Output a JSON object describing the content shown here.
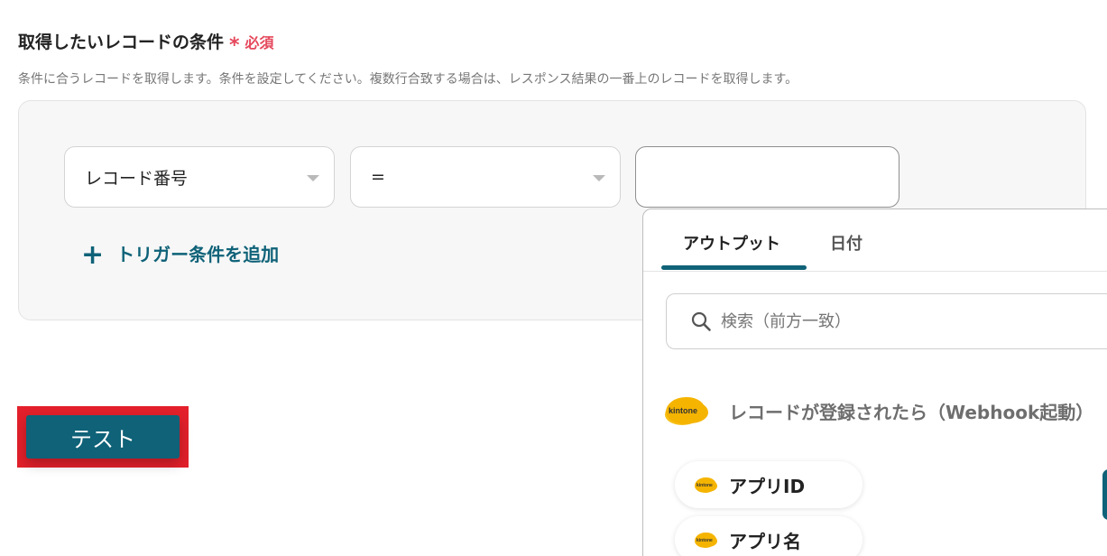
{
  "section": {
    "title": "取得したいレコードの条件",
    "required_mark": "*",
    "required_label": "必須",
    "description": "条件に合うレコードを取得します。条件を設定してください。複数行合致する場合は、レスポンス結果の一番上のレコードを取得します。"
  },
  "condition": {
    "field_select": "レコード番号",
    "operator_select": "=",
    "value": "",
    "add_label": "トリガー条件を追加",
    "add_icon": "+"
  },
  "test_button": {
    "label": "テスト"
  },
  "output_picker": {
    "tabs": [
      {
        "label": "アウトプット",
        "active": true
      },
      {
        "label": "日付",
        "active": false
      }
    ],
    "search_placeholder": "検索（前方一致）",
    "source": {
      "logo_text": "kintone",
      "title": "レコードが登録されたら（Webhook起動）"
    },
    "items": [
      {
        "label": "アプリID"
      },
      {
        "label": "アプリ名"
      }
    ]
  },
  "colors": {
    "accent": "#0f6278",
    "required": "#e5485c",
    "highlight": "#e3202b",
    "kintone_yellow": "#f5b400"
  }
}
